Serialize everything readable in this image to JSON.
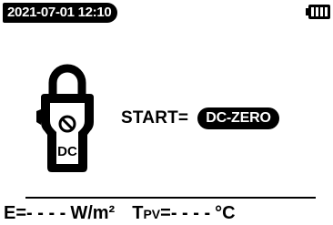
{
  "status_bar": {
    "datetime": "2021-07-01 12:10",
    "battery_icon": "battery-full-icon"
  },
  "measurement": {
    "icon": "dc-clamp-icon",
    "clamp_label": "DC",
    "start_label": "START=",
    "mode": "DC-ZERO"
  },
  "readings": {
    "irradiance_label": "E=",
    "irradiance_value": "- - - -",
    "irradiance_unit": "W/m²",
    "panel_temp_label": "T",
    "panel_temp_subscript": "PV",
    "panel_temp_equals": "=",
    "panel_temp_value": "- - - -",
    "panel_temp_unit": "°C"
  }
}
